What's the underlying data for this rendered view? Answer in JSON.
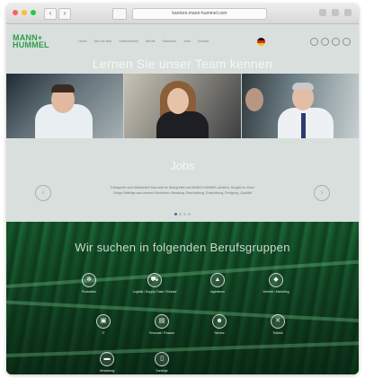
{
  "browser": {
    "url": "karriere.mann-hummel.com",
    "tab_strip": "",
    "colors": {
      "close": "#ff5f57",
      "minimize": "#febc2e",
      "zoom": "#28c840"
    }
  },
  "header": {
    "logo_line1": "MANN+",
    "logo_line2": "HUMMEL",
    "nav": [
      "Home",
      "Wer wir sind",
      "Unternehmen",
      "Berufe",
      "Standorte",
      "Jobs",
      "Kontakt"
    ],
    "language_flag": "de-flag-icon",
    "brand_color": "#2e9e4a"
  },
  "team": {
    "title": "Lernen Sie unser Team kennen"
  },
  "jobs": {
    "title": "Jobs",
    "text_line1": "Erfolgreich sind Mitarbeiter! Das wird im Übergreifen bei MANN+HUMMEL deutlich. Da gibt es einen",
    "text_line2": "Einige Beiträge aus unseren Bereichen: Beratung, Beschaffung, Entwicklung, Fertigung, Qualität"
  },
  "careers": {
    "title": "Wir suchen in folgenden Berufsgruppen",
    "categories": [
      {
        "label": "Produktion",
        "icon": "gear-icon"
      },
      {
        "label": "Logistik / Supply Chain / Einkauf",
        "icon": "truck-icon"
      },
      {
        "label": "Ingenieure",
        "icon": "helmet-icon"
      },
      {
        "label": "Vertrieb / Marketing",
        "icon": "car-icon"
      },
      {
        "label": "IT",
        "icon": "computer-icon"
      },
      {
        "label": "Personal / Finance",
        "icon": "document-icon"
      },
      {
        "label": "Service",
        "icon": "team-icon"
      },
      {
        "label": "Technik",
        "icon": "tools-icon"
      },
      {
        "label": "Verwaltung",
        "icon": "briefcase-icon"
      },
      {
        "label": "Sonstige",
        "icon": "clipboard-icon"
      }
    ]
  }
}
